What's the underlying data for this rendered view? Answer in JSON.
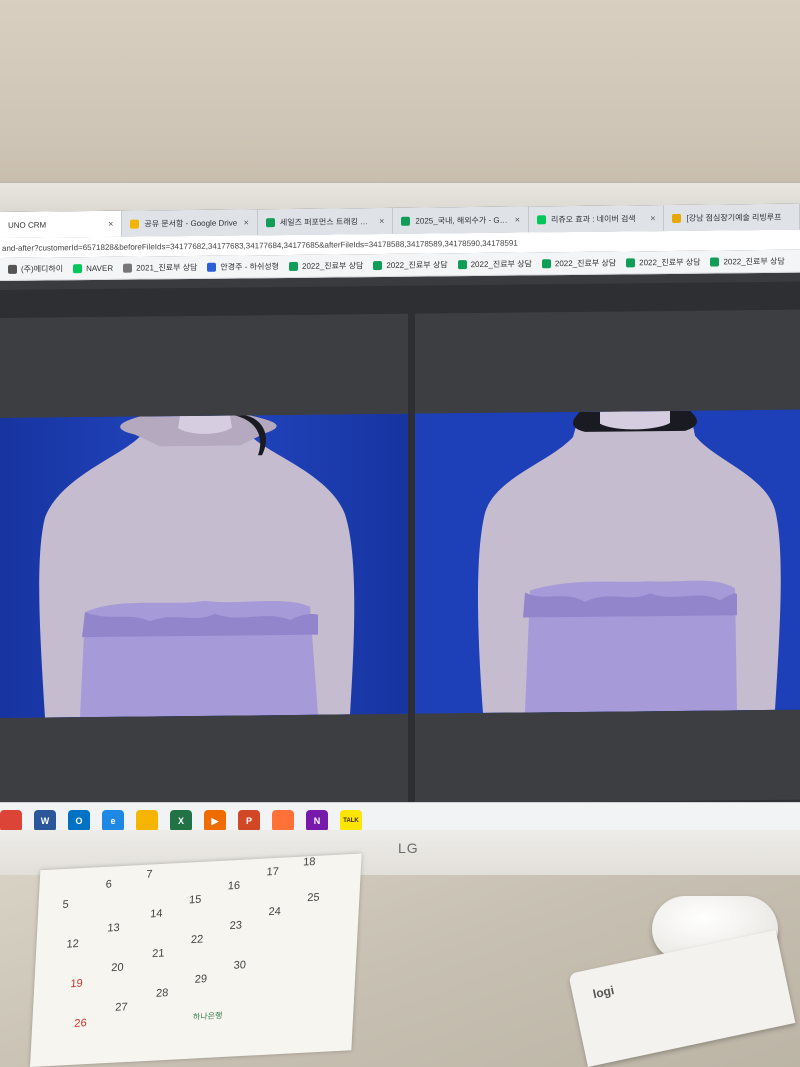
{
  "browser": {
    "tabs": [
      {
        "label": "UNO CRM",
        "color": "#888888"
      },
      {
        "label": "공유 문서함 - Google Drive",
        "color": "#f4b400"
      },
      {
        "label": "세일즈 퍼포먼스 트래킹 시트",
        "color": "#0f9d58"
      },
      {
        "label": "2025_국내, 해외수가 - Google S",
        "color": "#0f9d58"
      },
      {
        "label": "리쥬오 효과 : 네이버 검색",
        "color": "#03c75a"
      },
      {
        "label": "[강남 점심장기예술 리빙루프",
        "color": "#e6a800"
      }
    ],
    "url": "and-after?customerId=6571828&beforeFileIds=34177682,34177683,34177684,34177685&afterFileIds=34178588,34178589,34178590,34178591",
    "bookmarks": [
      {
        "label": "(주)메디하이",
        "color": "#555555"
      },
      {
        "label": "NAVER",
        "color": "#03c75a"
      },
      {
        "label": "2021_진료부 상담",
        "color": "#777777"
      },
      {
        "label": "안경주 - 하쉬성형",
        "color": "#2b5fd9"
      },
      {
        "label": "2022_진료부 상담",
        "color": "#0f9d58"
      },
      {
        "label": "2022_진료부 상담",
        "color": "#0f9d58"
      },
      {
        "label": "2022_진료부 상담",
        "color": "#0f9d58"
      },
      {
        "label": "2022_진료부 상담",
        "color": "#0f9d58"
      },
      {
        "label": "2022_진료부 상담",
        "color": "#0f9d58"
      },
      {
        "label": "2022_진료부 상담",
        "color": "#0f9d58"
      }
    ]
  },
  "taskbar": {
    "icons": [
      {
        "name": "chrome-icon",
        "color": "#db4437",
        "glyph": ""
      },
      {
        "name": "word-icon",
        "color": "#2b579a",
        "glyph": "W"
      },
      {
        "name": "outlook-icon",
        "color": "#0072c6",
        "glyph": "O"
      },
      {
        "name": "edge-icon",
        "color": "#1e88e5",
        "glyph": "e"
      },
      {
        "name": "paint-icon",
        "color": "#f4b400",
        "glyph": ""
      },
      {
        "name": "excel-icon",
        "color": "#217346",
        "glyph": "X"
      },
      {
        "name": "media-player-icon",
        "color": "#ef6c00",
        "glyph": "▶"
      },
      {
        "name": "powerpoint-icon",
        "color": "#d24726",
        "glyph": "P"
      },
      {
        "name": "firefox-icon",
        "color": "#ff7139",
        "glyph": ""
      },
      {
        "name": "onenote-icon",
        "color": "#7719aa",
        "glyph": "N"
      },
      {
        "name": "kakaotalk-icon",
        "color": "#fee500",
        "glyph": "TALK"
      }
    ]
  },
  "monitor": {
    "brand": "LG"
  },
  "calendar": {
    "dates": [
      {
        "n": "5",
        "red": false
      },
      {
        "n": "6",
        "red": false
      },
      {
        "n": "7",
        "red": false
      },
      {
        "n": "12",
        "red": false
      },
      {
        "n": "13",
        "red": false
      },
      {
        "n": "14",
        "red": false
      },
      {
        "n": "15",
        "red": false
      },
      {
        "n": "16",
        "red": false
      },
      {
        "n": "17",
        "red": false
      },
      {
        "n": "18",
        "red": false
      },
      {
        "n": "19",
        "red": true
      },
      {
        "n": "20",
        "red": false
      },
      {
        "n": "21",
        "red": false
      },
      {
        "n": "22",
        "red": false
      },
      {
        "n": "23",
        "red": false
      },
      {
        "n": "24",
        "red": false
      },
      {
        "n": "25",
        "red": false
      },
      {
        "n": "26",
        "red": true
      },
      {
        "n": "27",
        "red": false
      },
      {
        "n": "28",
        "red": false
      },
      {
        "n": "29",
        "red": false
      },
      {
        "n": "30",
        "red": false
      }
    ],
    "brand": "하나은행"
  },
  "keyboard": {
    "brand": "logi"
  },
  "colors": {
    "photo_bg": "#1d3fb8",
    "garment": "#a79ad8",
    "skin": "#c9bfd6"
  }
}
